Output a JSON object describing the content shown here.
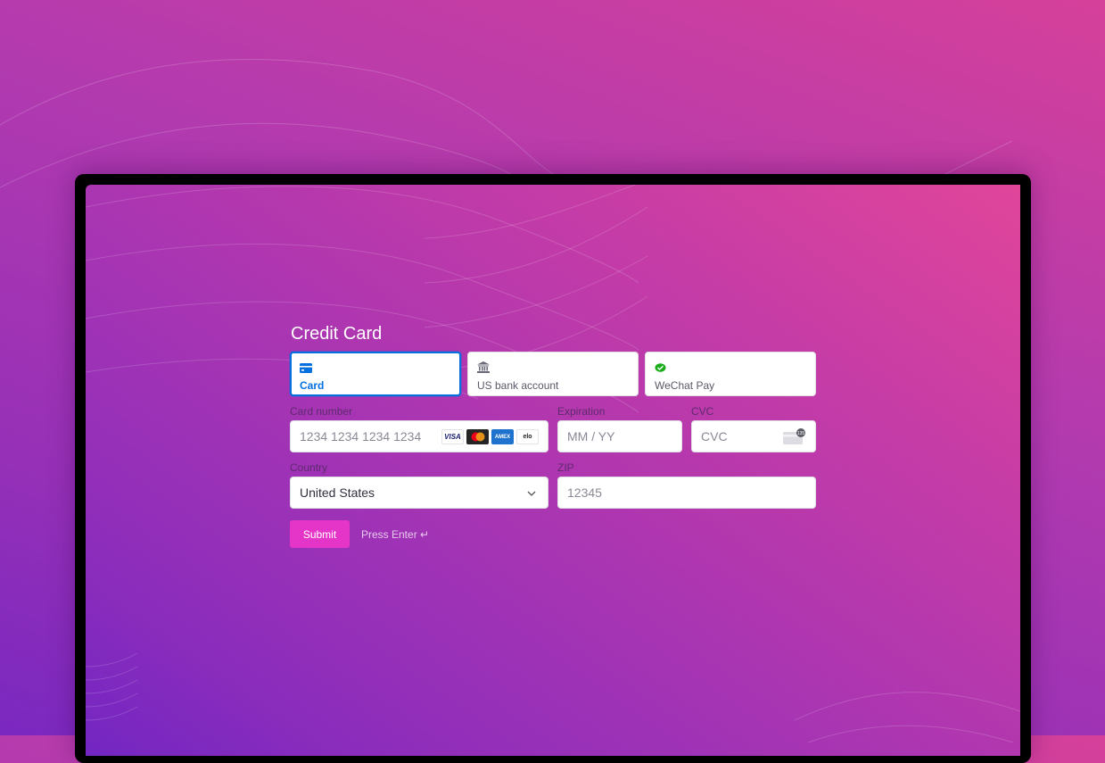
{
  "form": {
    "title": "Credit Card",
    "tabs": [
      {
        "label": "Card",
        "icon": "credit-card-icon",
        "active": true
      },
      {
        "label": "US bank account",
        "icon": "bank-icon",
        "active": false
      },
      {
        "label": "WeChat Pay",
        "icon": "wechat-icon",
        "active": false
      }
    ],
    "card_number": {
      "label": "Card number",
      "placeholder": "1234 1234 1234 1234",
      "value": ""
    },
    "card_brands": [
      "VISA",
      "Mastercard",
      "American Express",
      "elo"
    ],
    "expiration": {
      "label": "Expiration",
      "placeholder": "MM / YY",
      "value": ""
    },
    "cvc": {
      "label": "CVC",
      "placeholder": "CVC",
      "value": "",
      "hint_badge": "135"
    },
    "country": {
      "label": "Country",
      "value": "United States"
    },
    "zip": {
      "label": "ZIP",
      "placeholder": "12345",
      "value": ""
    },
    "submit_label": "Submit",
    "press_enter_hint": "Press Enter ↵"
  },
  "colors": {
    "accent": "#0570de",
    "submit": "#e535c8",
    "wechat": "#1aad19"
  }
}
